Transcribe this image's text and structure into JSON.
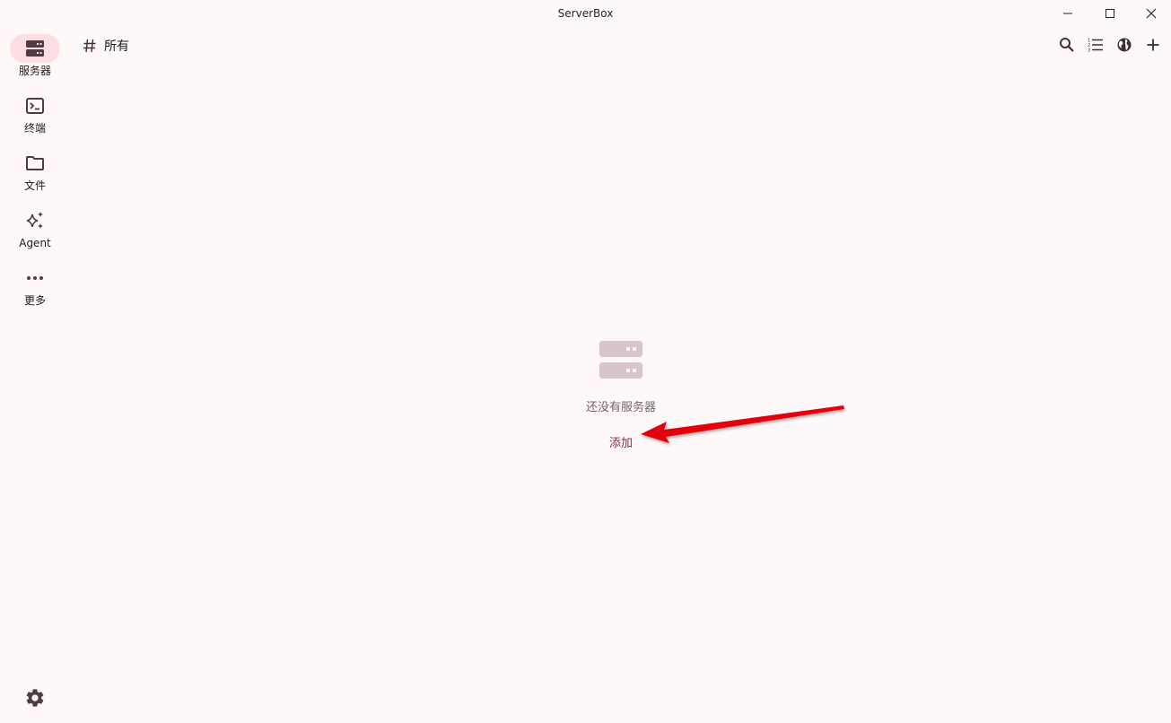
{
  "window": {
    "title": "ServerBox"
  },
  "rail": {
    "items": [
      {
        "label": "服务器",
        "icon": "server-icon",
        "active": true
      },
      {
        "label": "终端",
        "icon": "terminal-icon"
      },
      {
        "label": "文件",
        "icon": "folder-icon"
      },
      {
        "label": "Agent",
        "icon": "sparkle-icon"
      },
      {
        "label": "更多",
        "icon": "more-horiz-icon"
      }
    ],
    "settings_icon": "gear-icon"
  },
  "header": {
    "group_label": "所有",
    "actions": [
      "search-icon",
      "list-numbered-icon",
      "globe-icon",
      "add-icon"
    ]
  },
  "empty_state": {
    "message": "还没有服务器",
    "add_label": "添加"
  },
  "colors": {
    "background": "#fff8f8",
    "rail_active": "#fedee4",
    "accent": "#7a2f52",
    "annotation_arrow": "#e3000f"
  }
}
